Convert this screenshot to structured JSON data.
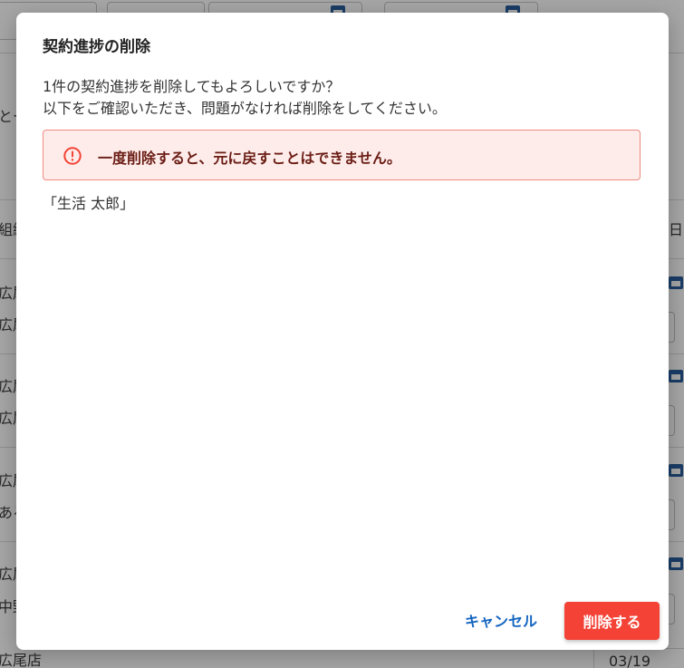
{
  "background": {
    "left_snippets": [
      "とー",
      "組織",
      "広尾",
      "広尾",
      "広尾",
      "広尾",
      "広尾",
      "ある",
      "広尾",
      "中野",
      "広尾店"
    ],
    "right_header": "日",
    "date_value": "03/19"
  },
  "dialog": {
    "title": "契約進捗の削除",
    "message_line1": "1件の契約進捗を削除してもよろしいですか？",
    "message_line2": "以下をご確認いただき、問題がなければ削除をしてください。",
    "warning": "一度削除すると、元に戻すことはできません。",
    "target": "「生活 太郎」",
    "cancel_label": "キャンセル",
    "delete_label": "削除する"
  },
  "colors": {
    "danger": "#f44336",
    "warning_bg": "#fdecea",
    "warning_text": "#6b1d15",
    "link": "#1565c0",
    "overlay": "#a6a6a6"
  },
  "icons": {
    "warning": "error-outline-icon",
    "calendar": "calendar-icon"
  }
}
